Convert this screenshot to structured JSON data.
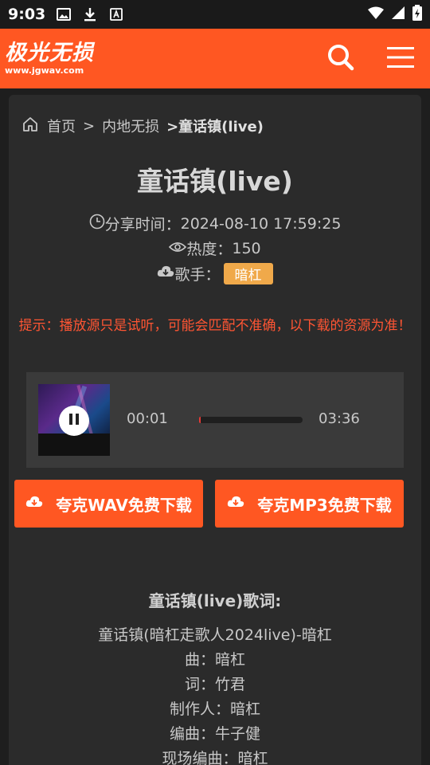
{
  "status_bar": {
    "time": "9:03"
  },
  "header": {
    "logo_title": "极光无损",
    "logo_url": "www.jgwav.com"
  },
  "breadcrumb": {
    "home": "首页",
    "sep1": ">",
    "category": "内地无损",
    "current": ">童话镇(live)"
  },
  "song": {
    "title": "童话镇(live)",
    "share_time_label": "分享时间：",
    "share_time": "2024-08-10 17:59:25",
    "heat_label": "热度：",
    "heat": "150",
    "singer_label": "歌手：",
    "singer": "暗杠"
  },
  "tip": "提示：播放源只是试听，可能会匹配不准确，以下载的资源为准！",
  "player": {
    "current_time": "00:01",
    "total_time": "03:36",
    "progress": 0.005,
    "state": "playing"
  },
  "downloads": {
    "wav": "夸克WAV免费下载",
    "mp3": "夸克MP3免费下载"
  },
  "lyrics": {
    "title": "童话镇(live)歌词:",
    "lines": [
      "童话镇(暗杠走歌人2024live)-暗杠",
      "曲：暗杠",
      "词：竹君",
      "制作人：暗杠",
      "编曲：牛子健",
      "现场编曲：暗杠"
    ]
  },
  "colors": {
    "accent": "#ff5722",
    "badge": "#f0a94a",
    "tip": "#ff5533",
    "background": "#1e1e1e",
    "card": "#2b2b2b"
  }
}
